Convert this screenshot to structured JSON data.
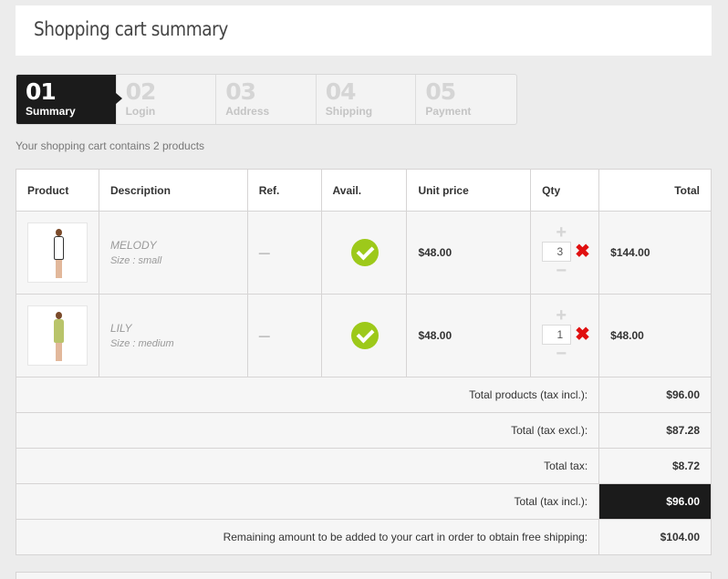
{
  "page_title": "Shopping cart summary",
  "steps": [
    {
      "num": "01",
      "label": "Summary"
    },
    {
      "num": "02",
      "label": "Login"
    },
    {
      "num": "03",
      "label": "Address"
    },
    {
      "num": "04",
      "label": "Shipping"
    },
    {
      "num": "05",
      "label": "Payment"
    }
  ],
  "cart_count_text": "Your shopping cart contains 2 products",
  "table": {
    "headers": [
      "Product",
      "Description",
      "Ref.",
      "Avail.",
      "Unit price",
      "Qty",
      "Total"
    ],
    "items": [
      {
        "name": "MELODY",
        "size": "Size : small",
        "ref": "—",
        "unit_price": "$48.00",
        "qty": "3",
        "total": "$144.00",
        "dress_color": "#ffffff"
      },
      {
        "name": "LILY",
        "size": "Size : medium",
        "ref": "—",
        "unit_price": "$48.00",
        "qty": "1",
        "total": "$48.00",
        "dress_color": "#b9c46a"
      }
    ],
    "summary": [
      {
        "label": "Total products (tax incl.):",
        "value": "$96.00"
      },
      {
        "label": "Total (tax excl.):",
        "value": "$87.28"
      },
      {
        "label": "Total tax:",
        "value": "$8.72"
      },
      {
        "label": "Total (tax incl.):",
        "value": "$96.00"
      },
      {
        "label": "Remaining amount to be added to your cart in order to obtain free shipping:",
        "value": "$104.00"
      }
    ]
  },
  "colors": {
    "accent_dark": "#1b1b1b",
    "available_green": "#9dc91a",
    "delete_red": "#e01010"
  }
}
